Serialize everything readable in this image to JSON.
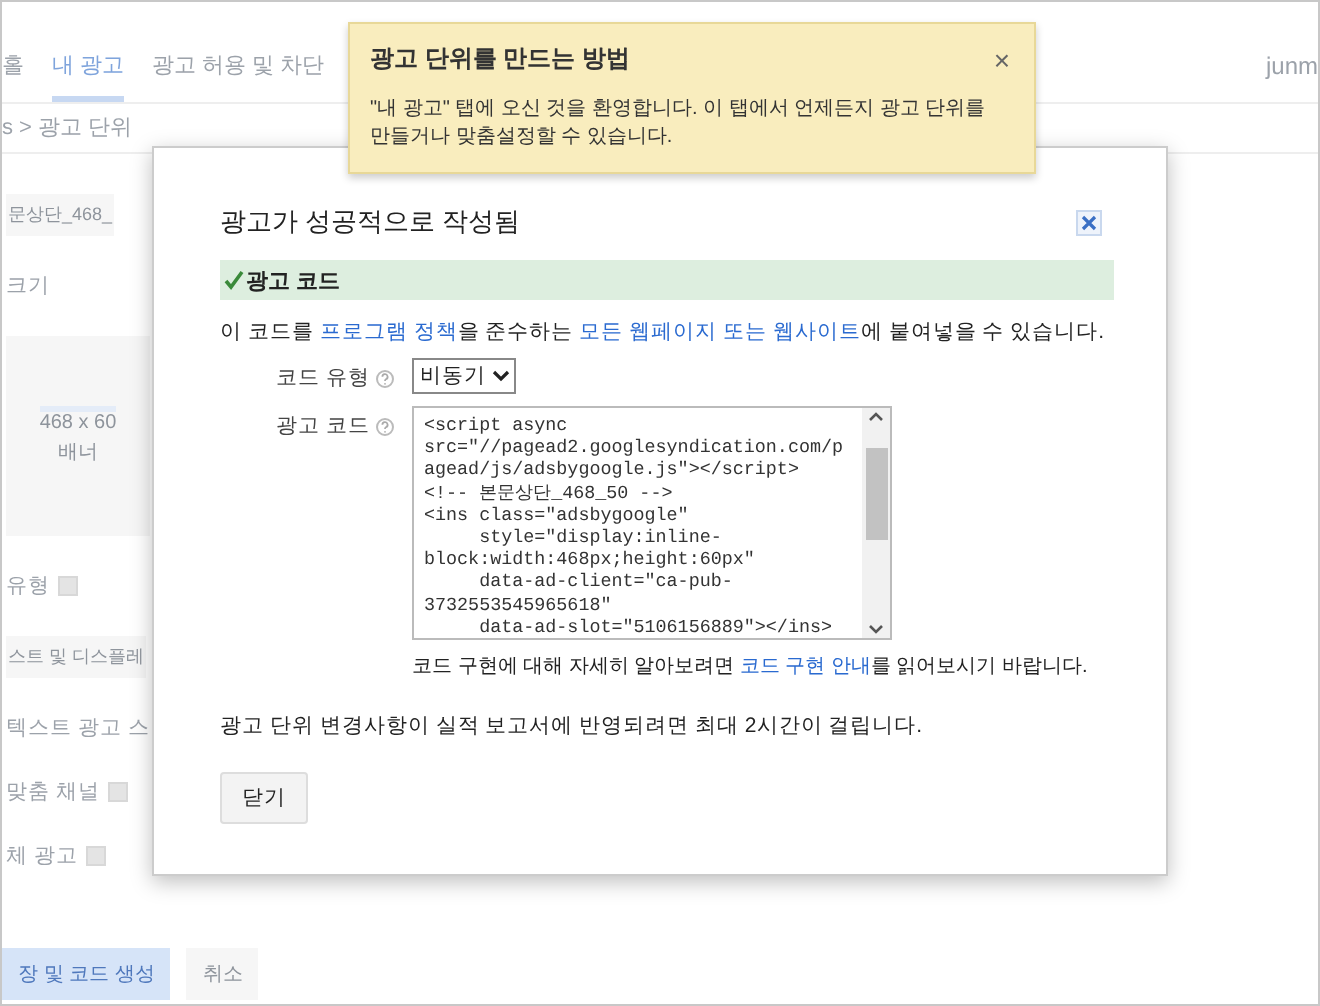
{
  "background_page": {
    "nav_tabs": [
      {
        "label": "홀",
        "selected": false
      },
      {
        "label": "내 광고",
        "selected": true
      },
      {
        "label": "광고 허용 및 차단",
        "selected": false
      }
    ],
    "account": "junm",
    "breadcrumb": "s > 광고 단위",
    "items": [
      {
        "kind": "field",
        "text": "문상단_468_"
      },
      {
        "kind": "label",
        "text": "크기",
        "help": false
      },
      {
        "kind": "preview",
        "text": "468 x 60",
        "caption": "배너"
      },
      {
        "kind": "label",
        "text": "유형",
        "help": true
      },
      {
        "kind": "field",
        "text": "스트 및 디스플레"
      },
      {
        "kind": "label",
        "text": "텍스트 광고 스",
        "help": false
      },
      {
        "kind": "label",
        "text": "맞춤 채널",
        "help": true
      },
      {
        "kind": "label",
        "text": "체 광고",
        "help": true
      }
    ],
    "buttons": [
      {
        "label": "장 및 코드 생성",
        "primary": true
      },
      {
        "label": "취소",
        "primary": false
      }
    ]
  },
  "tooltip": {
    "title": "광고 단위를 만드는 방법",
    "close": "×",
    "body": "\"내 광고\" 탭에 오신 것을 환영합니다. 이 탭에서 언제든지 광고 단위를 만들거나 맞춤설정할 수 있습니다."
  },
  "dialog": {
    "title": "광고가 성공적으로 작성됨",
    "section": "광고 코드",
    "intro": [
      {
        "text": "이 코드를 ",
        "link": false
      },
      {
        "text": "프로그램 정책",
        "link": true
      },
      {
        "text": "을 준수하는 ",
        "link": false
      },
      {
        "text": "모든 웹페이지 또는 웹사이트",
        "link": true
      },
      {
        "text": "에 붙여넣을 수 있습니다.",
        "link": false
      }
    ],
    "code_type_label": "코드 유형",
    "code_type": "비동기",
    "code_label": "광고 코드",
    "code_lines": [
      "<script async",
      "src=\"//pagead2.googlesyndication.com/p",
      "agead/js/adsbygoogle.js\"></script>",
      "<!-- 본문상단_468_50 -->",
      "<ins class=\"adsbygoogle\"",
      "     style=\"display:inline-",
      "block:width:468px;height:60px\"",
      "     data-ad-client=\"ca-pub-",
      "3732553545965618\"",
      "     data-ad-slot=\"5106156889\"></ins>"
    ],
    "help_note": [
      {
        "text": "코드 구현에 대해 자세히 알아보려면 ",
        "link": false
      },
      {
        "text": "코드 구현 안내",
        "link": true
      },
      {
        "text": "를 읽어보시기 바랍니다.",
        "link": false
      }
    ],
    "notice": "광고 단위 변경사항이 실적 보고서에 반영되려면 최대 2시간이 걸립니다.",
    "close_button": "닫기"
  }
}
